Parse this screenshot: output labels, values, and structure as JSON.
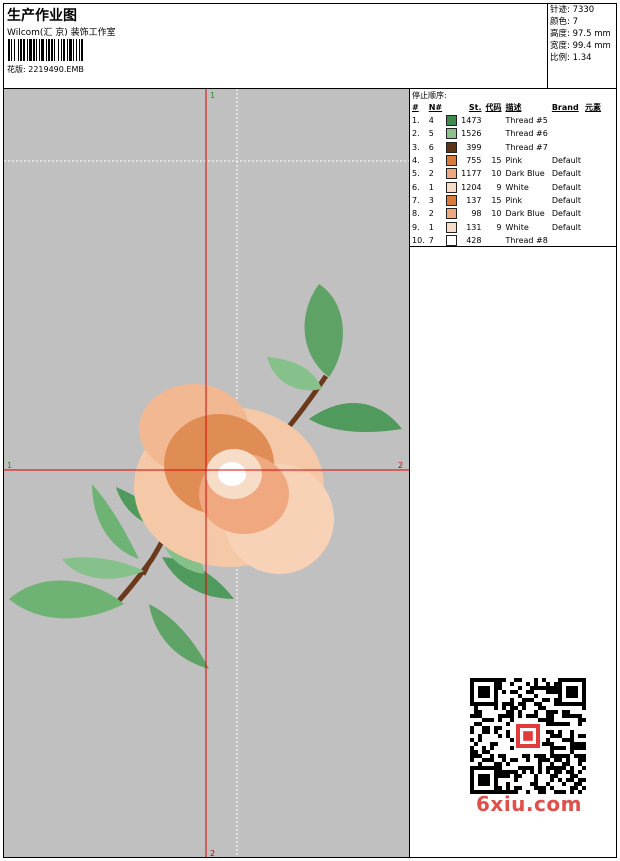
{
  "header": {
    "title": "生产作业图",
    "subtitle": "Wilcom(汇 京) 装饰工作室",
    "design_line": "花版: 2219490.EMB"
  },
  "stats": [
    {
      "label": "针迹:",
      "value": "7330"
    },
    {
      "label": "颜色:",
      "value": "7"
    },
    {
      "label": "高度:",
      "value": "97.5 mm"
    },
    {
      "label": "宽度:",
      "value": "99.4 mm"
    },
    {
      "label": "比例:",
      "value": "1.34"
    }
  ],
  "sequence": {
    "title": "停止顺序:",
    "headers": [
      "#",
      "N#",
      "St.",
      "代码",
      "描述",
      "Brand",
      "元素"
    ],
    "rows": [
      {
        "idx": "1.",
        "n": "4",
        "color": "#3e8a4f",
        "st": "1473",
        "code": "",
        "desc": "Thread #5",
        "brand": ""
      },
      {
        "idx": "2.",
        "n": "5",
        "color": "#8cc18e",
        "st": "1526",
        "code": "",
        "desc": "Thread #6",
        "brand": ""
      },
      {
        "idx": "3.",
        "n": "6",
        "color": "#5a3319",
        "st": "399",
        "code": "",
        "desc": "Thread #7",
        "brand": ""
      },
      {
        "idx": "4.",
        "n": "3",
        "color": "#d87b3a",
        "st": "755",
        "code": "15",
        "desc": "Pink",
        "brand": "Default"
      },
      {
        "idx": "5.",
        "n": "2",
        "color": "#f0a880",
        "st": "1177",
        "code": "10",
        "desc": "Dark Blue",
        "brand": "Default"
      },
      {
        "idx": "6.",
        "n": "1",
        "color": "#f7ddc8",
        "st": "1204",
        "code": "9",
        "desc": "White",
        "brand": "Default"
      },
      {
        "idx": "7.",
        "n": "3",
        "color": "#d87b3a",
        "st": "137",
        "code": "15",
        "desc": "Pink",
        "brand": "Default"
      },
      {
        "idx": "8.",
        "n": "2",
        "color": "#f0a880",
        "st": "98",
        "code": "10",
        "desc": "Dark Blue",
        "brand": "Default"
      },
      {
        "idx": "9.",
        "n": "1",
        "color": "#f7ddc8",
        "st": "131",
        "code": "9",
        "desc": "White",
        "brand": "Default"
      },
      {
        "idx": "10.",
        "n": "7",
        "color": "#ffffff",
        "st": "428",
        "code": "",
        "desc": "Thread #8",
        "brand": ""
      }
    ]
  },
  "guides": {
    "v_top": "1",
    "v_bottom": "2",
    "h_left": "1",
    "h_right": "2"
  },
  "colors": {
    "guide": "#e00000",
    "preview_bg": "#c0c0c0",
    "leaf_dark": "#4f9a5c",
    "leaf_light": "#86c08a",
    "stem": "#6b3a1c",
    "petal_light": "#f5c9a8",
    "petal_dark": "#d8763a"
  },
  "watermark": {
    "site": "6xiu.com"
  }
}
